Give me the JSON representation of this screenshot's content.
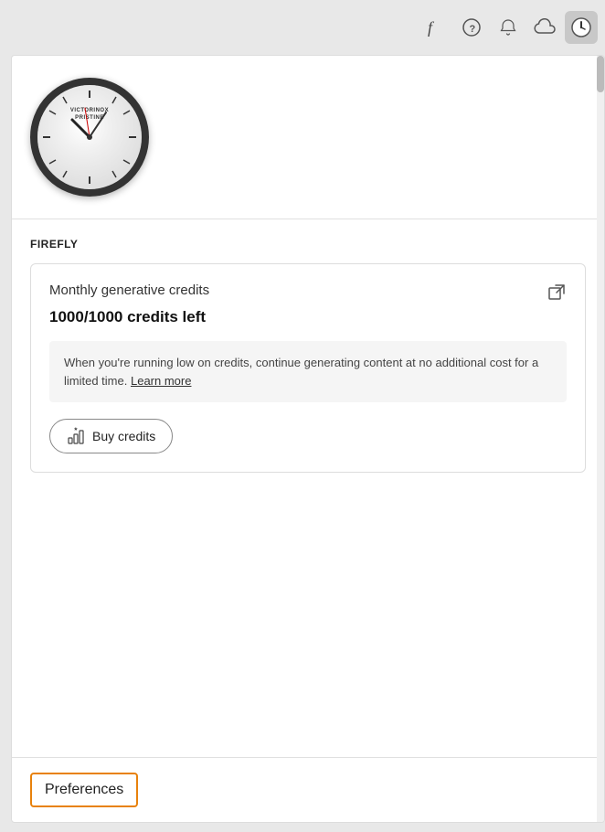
{
  "toolbar": {
    "font_icon": "𝑓",
    "help_icon": "help-circle",
    "bell_icon": "bell",
    "cloud_icon": "cloud",
    "clock_icon": "clock"
  },
  "panel": {
    "clock": {
      "brand_line1": "VICTORINOX",
      "brand_line2": "PRISTINE"
    },
    "firefly": {
      "section_label": "FIREFLY",
      "card": {
        "title": "Monthly generative credits",
        "credits_text": "1000/1000 credits left",
        "info_text": "When you're running low on credits, continue generating content at no additional cost for a limited time.",
        "learn_more_label": "Learn more",
        "buy_button_label": "Buy credits"
      }
    },
    "preferences": {
      "label": "Preferences"
    }
  }
}
